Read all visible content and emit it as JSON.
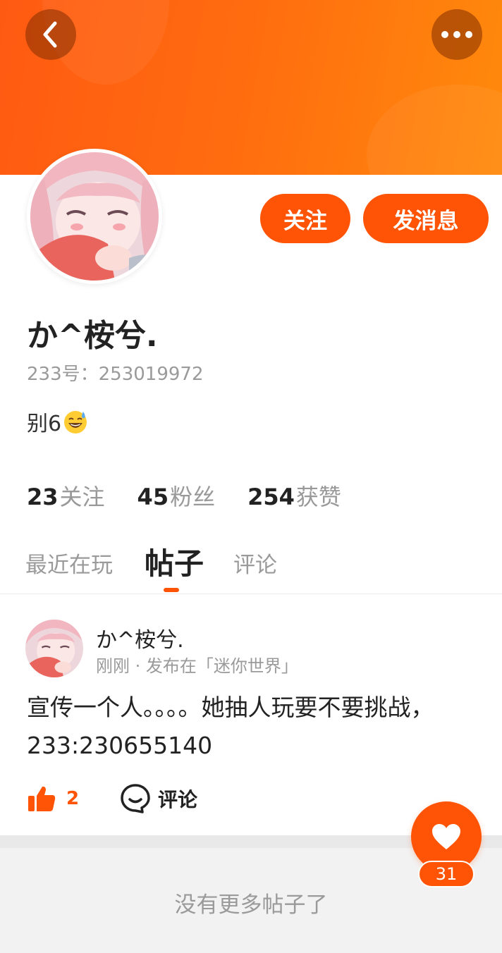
{
  "profile": {
    "follow_label": "关注",
    "message_label": "发消息",
    "username": "か^桉兮.",
    "uid_text": "233号：253019972",
    "bio": "别6"
  },
  "stats": {
    "following_count": "23",
    "following_label": "关注",
    "followers_count": "45",
    "followers_label": "粉丝",
    "likes_count": "254",
    "likes_label": "获赞"
  },
  "tabs": {
    "recent": "最近在玩",
    "posts": "帖子",
    "comments": "评论",
    "active": "posts"
  },
  "post": {
    "author": "か^桉兮.",
    "meta": "刚刚 · 发布在「迷你世界」",
    "content": "宣传一个人。。。。她抽人玩要不要挑战，233:230655140",
    "like_count": "2",
    "comment_label": "评论"
  },
  "footer": {
    "no_more_text": "没有更多帖子了"
  },
  "favorite": {
    "count": "31"
  },
  "colors": {
    "accent": "#ff5405",
    "header_gradient_start": "#ff5a12",
    "header_gradient_end": "#ff8a0c"
  },
  "icons": {
    "back": "chevron-left-icon",
    "more": "more-dots-icon",
    "like": "thumbs-up-icon",
    "comment": "comment-bubble-icon",
    "favorite": "heart-icon",
    "bio_emoji": "sweat-smile-emoji-icon"
  }
}
